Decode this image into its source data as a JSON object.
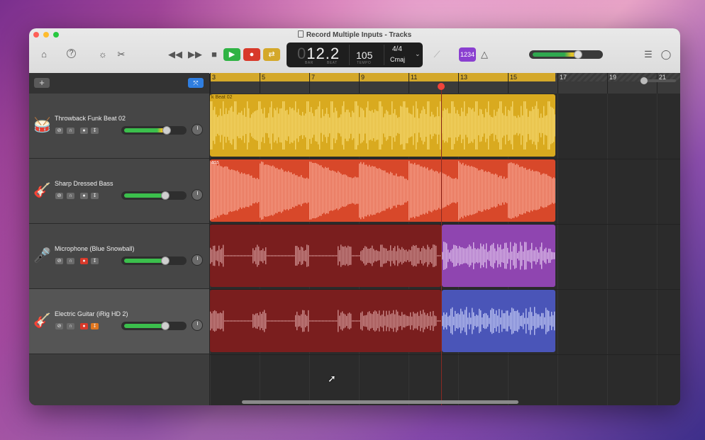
{
  "window": {
    "title": "Record Multiple Inputs - Tracks"
  },
  "toolbar": {
    "left_icons": [
      "library-icon",
      "help-icon",
      "smart-controls-icon",
      "editors-icon"
    ],
    "transport": {
      "rewind": "◀◀",
      "forward": "▶▶",
      "stop": "■",
      "play": "▶",
      "record": "●",
      "cycle": "⇄"
    },
    "lcd": {
      "bar_dim": "0",
      "bar_value": "12.2",
      "bar_label": "BAR",
      "beat_label": "BEAT",
      "tempo": "105",
      "tempo_label": "TEMPO",
      "time_signature": "4/4",
      "key": "Cmaj"
    },
    "count_in": "1234",
    "master_volume_fraction": 0.68,
    "right_icons": [
      "note-pad-icon",
      "loop-browser-icon"
    ]
  },
  "track_area": {
    "add_symbol": "+",
    "smart_symbol": "⤧"
  },
  "ruler": {
    "bars": [
      "3",
      "5",
      "7",
      "9",
      "11",
      "13",
      "15",
      "17",
      "19",
      "21"
    ]
  },
  "tracks": [
    {
      "name": "Throwback Funk Beat 02",
      "icon": "drum-kit-icon",
      "icon_char": "🥁",
      "icon_color": "#e8c32a",
      "volume": 0.72,
      "rec_on": false,
      "mon_on": false,
      "region": {
        "name": "k Beat 02",
        "color": "#d9aa1f",
        "wave": "#f3d56a"
      }
    },
    {
      "name": "Sharp Dressed Bass",
      "icon": "bass-guitar-icon",
      "icon_char": "🎸",
      "icon_color": "#e8572b",
      "volume": 0.7,
      "rec_on": false,
      "mon_on": false,
      "region": {
        "name": "ass",
        "color": "#d8482a",
        "wave": "#f6a08a"
      }
    },
    {
      "name": "Microphone (Blue Snowball)",
      "icon": "microphone-icon",
      "icon_char": "🎤",
      "icon_color": "#b56ad8",
      "volume": 0.7,
      "rec_on": true,
      "mon_on": false,
      "region": {
        "name": "",
        "color": "#7a1e1e",
        "wave": "#c98a8a",
        "take_color": "#8f45b0",
        "take_wave": "#d8b6e6"
      }
    },
    {
      "name": "Electric Guitar (iRig HD 2)",
      "icon": "electric-guitar-icon",
      "icon_char": "🎸",
      "icon_color": "#3f6fe0",
      "volume": 0.7,
      "rec_on": true,
      "mon_on": true,
      "region": {
        "name": "",
        "color": "#7a1e1e",
        "wave": "#c98a8a",
        "take_color": "#4a55b8",
        "take_wave": "#b8bfef"
      }
    }
  ]
}
